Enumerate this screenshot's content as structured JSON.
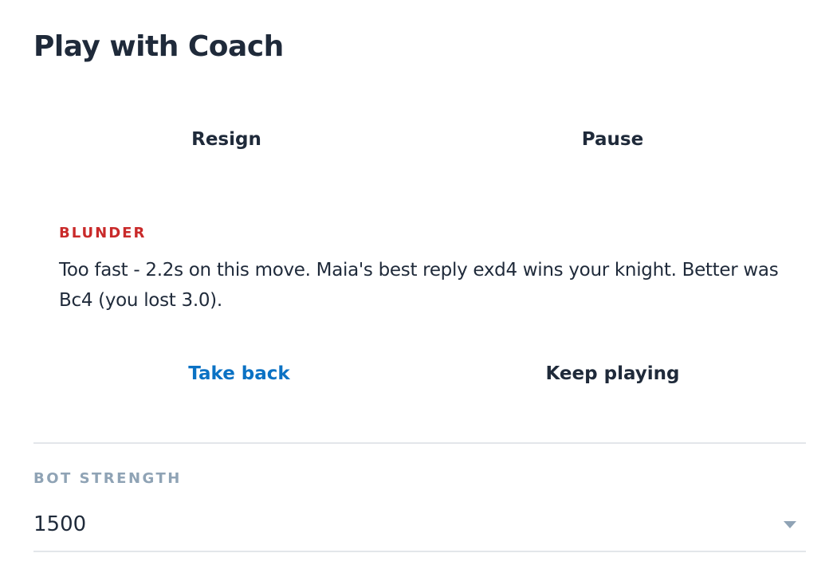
{
  "header": {
    "title": "Play with Coach"
  },
  "controls": {
    "resign_label": "Resign",
    "pause_label": "Pause"
  },
  "feedback": {
    "verdict": "BLUNDER",
    "verdict_color": "#c92a2a",
    "message": "Too fast - 2.2s on this move. Maia's best reply exd4 wins your knight. Better was Bc4 (you lost 3.0).",
    "take_back_label": "Take back",
    "take_back_color": "#0b72c4",
    "keep_playing_label": "Keep playing"
  },
  "settings": {
    "bot_strength_label": "BOT STRENGTH",
    "bot_strength_value": "1500",
    "dropdown_icon": "caret-down-icon"
  }
}
